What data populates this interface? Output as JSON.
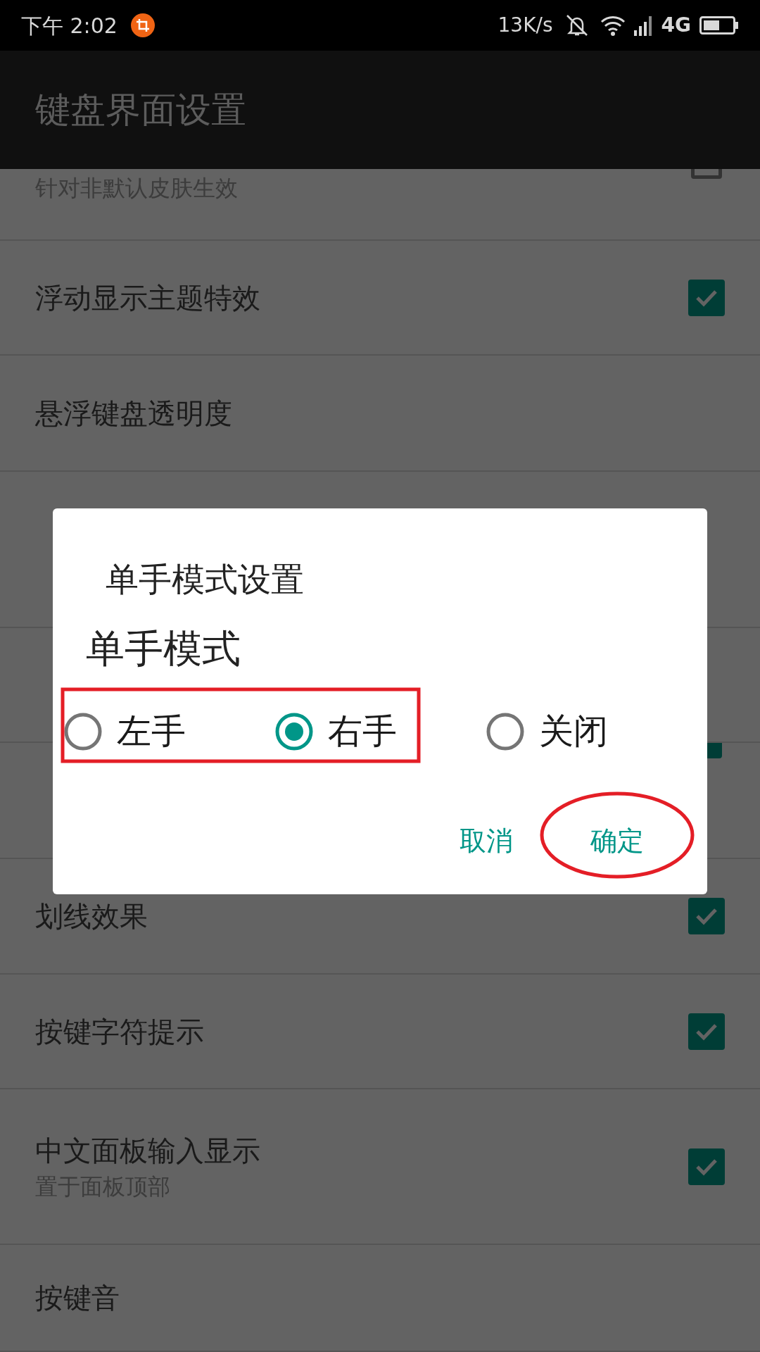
{
  "status_bar": {
    "time": "下午 2:02",
    "speed": "13K/s",
    "network": "4G"
  },
  "app_bar": {
    "title": "键盘界面设置"
  },
  "settings": [
    {
      "subtitle": "针对非默认皮肤生效",
      "kind": "checkbox",
      "checked": false
    },
    {
      "title": "浮动显示主题特效",
      "kind": "checkbox",
      "checked": true
    },
    {
      "title": "悬浮键盘透明度",
      "kind": "plain"
    },
    {
      "kind": "plain"
    },
    {
      "kind": "plain"
    },
    {
      "kind": "checkbox",
      "checked": true
    },
    {
      "title": "划线效果",
      "kind": "checkbox",
      "checked": true
    },
    {
      "title": "按键字符提示",
      "kind": "checkbox",
      "checked": true
    },
    {
      "title": "中文面板输入显示",
      "subtitle": "置于面板顶部",
      "kind": "checkbox",
      "checked": true
    },
    {
      "title": "按键音",
      "kind": "plain"
    }
  ],
  "dialog": {
    "title": "单手模式设置",
    "label": "单手模式",
    "options": [
      {
        "label": "左手",
        "selected": false
      },
      {
        "label": "右手",
        "selected": true
      },
      {
        "label": "关闭",
        "selected": false
      }
    ],
    "buttons": [
      "取消",
      "确定"
    ]
  }
}
